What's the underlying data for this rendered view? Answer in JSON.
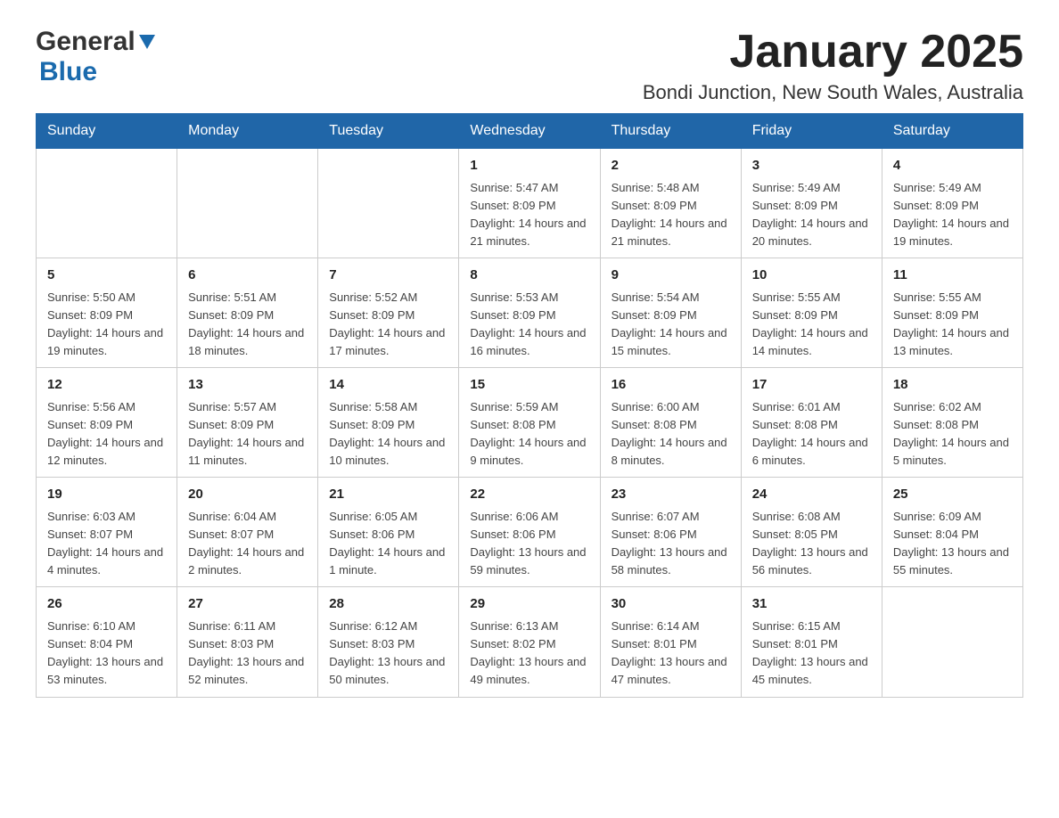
{
  "header": {
    "logo_general": "General",
    "logo_blue": "Blue",
    "month_title": "January 2025",
    "location": "Bondi Junction, New South Wales, Australia"
  },
  "calendar": {
    "days_of_week": [
      "Sunday",
      "Monday",
      "Tuesday",
      "Wednesday",
      "Thursday",
      "Friday",
      "Saturday"
    ],
    "weeks": [
      [
        {
          "day": "",
          "info": ""
        },
        {
          "day": "",
          "info": ""
        },
        {
          "day": "",
          "info": ""
        },
        {
          "day": "1",
          "info": "Sunrise: 5:47 AM\nSunset: 8:09 PM\nDaylight: 14 hours\nand 21 minutes."
        },
        {
          "day": "2",
          "info": "Sunrise: 5:48 AM\nSunset: 8:09 PM\nDaylight: 14 hours\nand 21 minutes."
        },
        {
          "day": "3",
          "info": "Sunrise: 5:49 AM\nSunset: 8:09 PM\nDaylight: 14 hours\nand 20 minutes."
        },
        {
          "day": "4",
          "info": "Sunrise: 5:49 AM\nSunset: 8:09 PM\nDaylight: 14 hours\nand 19 minutes."
        }
      ],
      [
        {
          "day": "5",
          "info": "Sunrise: 5:50 AM\nSunset: 8:09 PM\nDaylight: 14 hours\nand 19 minutes."
        },
        {
          "day": "6",
          "info": "Sunrise: 5:51 AM\nSunset: 8:09 PM\nDaylight: 14 hours\nand 18 minutes."
        },
        {
          "day": "7",
          "info": "Sunrise: 5:52 AM\nSunset: 8:09 PM\nDaylight: 14 hours\nand 17 minutes."
        },
        {
          "day": "8",
          "info": "Sunrise: 5:53 AM\nSunset: 8:09 PM\nDaylight: 14 hours\nand 16 minutes."
        },
        {
          "day": "9",
          "info": "Sunrise: 5:54 AM\nSunset: 8:09 PM\nDaylight: 14 hours\nand 15 minutes."
        },
        {
          "day": "10",
          "info": "Sunrise: 5:55 AM\nSunset: 8:09 PM\nDaylight: 14 hours\nand 14 minutes."
        },
        {
          "day": "11",
          "info": "Sunrise: 5:55 AM\nSunset: 8:09 PM\nDaylight: 14 hours\nand 13 minutes."
        }
      ],
      [
        {
          "day": "12",
          "info": "Sunrise: 5:56 AM\nSunset: 8:09 PM\nDaylight: 14 hours\nand 12 minutes."
        },
        {
          "day": "13",
          "info": "Sunrise: 5:57 AM\nSunset: 8:09 PM\nDaylight: 14 hours\nand 11 minutes."
        },
        {
          "day": "14",
          "info": "Sunrise: 5:58 AM\nSunset: 8:09 PM\nDaylight: 14 hours\nand 10 minutes."
        },
        {
          "day": "15",
          "info": "Sunrise: 5:59 AM\nSunset: 8:08 PM\nDaylight: 14 hours\nand 9 minutes."
        },
        {
          "day": "16",
          "info": "Sunrise: 6:00 AM\nSunset: 8:08 PM\nDaylight: 14 hours\nand 8 minutes."
        },
        {
          "day": "17",
          "info": "Sunrise: 6:01 AM\nSunset: 8:08 PM\nDaylight: 14 hours\nand 6 minutes."
        },
        {
          "day": "18",
          "info": "Sunrise: 6:02 AM\nSunset: 8:08 PM\nDaylight: 14 hours\nand 5 minutes."
        }
      ],
      [
        {
          "day": "19",
          "info": "Sunrise: 6:03 AM\nSunset: 8:07 PM\nDaylight: 14 hours\nand 4 minutes."
        },
        {
          "day": "20",
          "info": "Sunrise: 6:04 AM\nSunset: 8:07 PM\nDaylight: 14 hours\nand 2 minutes."
        },
        {
          "day": "21",
          "info": "Sunrise: 6:05 AM\nSunset: 8:06 PM\nDaylight: 14 hours\nand 1 minute."
        },
        {
          "day": "22",
          "info": "Sunrise: 6:06 AM\nSunset: 8:06 PM\nDaylight: 13 hours\nand 59 minutes."
        },
        {
          "day": "23",
          "info": "Sunrise: 6:07 AM\nSunset: 8:06 PM\nDaylight: 13 hours\nand 58 minutes."
        },
        {
          "day": "24",
          "info": "Sunrise: 6:08 AM\nSunset: 8:05 PM\nDaylight: 13 hours\nand 56 minutes."
        },
        {
          "day": "25",
          "info": "Sunrise: 6:09 AM\nSunset: 8:04 PM\nDaylight: 13 hours\nand 55 minutes."
        }
      ],
      [
        {
          "day": "26",
          "info": "Sunrise: 6:10 AM\nSunset: 8:04 PM\nDaylight: 13 hours\nand 53 minutes."
        },
        {
          "day": "27",
          "info": "Sunrise: 6:11 AM\nSunset: 8:03 PM\nDaylight: 13 hours\nand 52 minutes."
        },
        {
          "day": "28",
          "info": "Sunrise: 6:12 AM\nSunset: 8:03 PM\nDaylight: 13 hours\nand 50 minutes."
        },
        {
          "day": "29",
          "info": "Sunrise: 6:13 AM\nSunset: 8:02 PM\nDaylight: 13 hours\nand 49 minutes."
        },
        {
          "day": "30",
          "info": "Sunrise: 6:14 AM\nSunset: 8:01 PM\nDaylight: 13 hours\nand 47 minutes."
        },
        {
          "day": "31",
          "info": "Sunrise: 6:15 AM\nSunset: 8:01 PM\nDaylight: 13 hours\nand 45 minutes."
        },
        {
          "day": "",
          "info": ""
        }
      ]
    ]
  }
}
